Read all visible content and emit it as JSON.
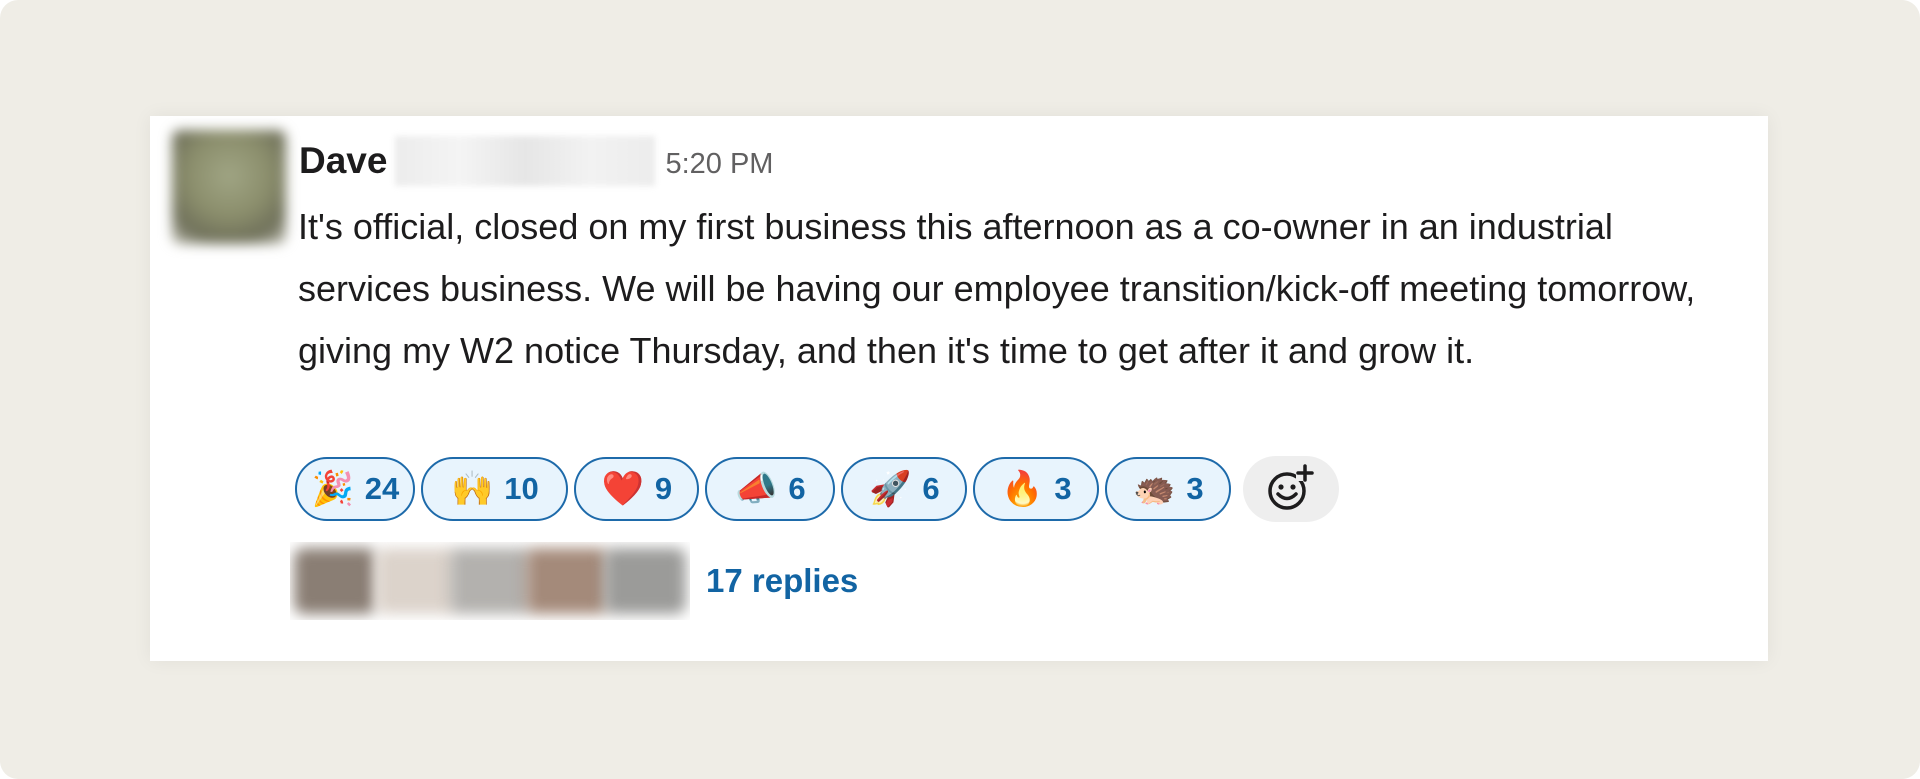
{
  "message": {
    "author": "Dave",
    "timestamp": "5:20 PM",
    "text": "It's official, closed on my first business this afternoon as a co-owner in an industrial services business. We will be having our employee transition/kick-off meeting tomorrow, giving my W2 notice Thursday, and then it's time to get after it and grow it."
  },
  "reactions": [
    {
      "icon": "party-popper-icon",
      "emoji": "🎉",
      "count": "24"
    },
    {
      "icon": "high-five-icon",
      "emoji": "🙌",
      "count": "10"
    },
    {
      "icon": "heart-icon",
      "emoji": "❤️",
      "count": "9"
    },
    {
      "icon": "megaphone-icon",
      "emoji": "📣",
      "count": "6"
    },
    {
      "icon": "rocket-icon",
      "emoji": "🚀",
      "count": "6"
    },
    {
      "icon": "fire-icon",
      "emoji": "🔥",
      "count": "3"
    },
    {
      "icon": "sonic-icon",
      "emoji": "🦔",
      "count": "3"
    }
  ],
  "thread": {
    "replies_label": "17 replies"
  },
  "colors": {
    "page_background": "#efede6",
    "card_background": "#ffffff",
    "reaction_border": "#1d6aaa",
    "reaction_background": "#e8f4fd",
    "link_blue": "#1264a3",
    "text": "#1d1c1d",
    "timestamp": "#616061"
  }
}
